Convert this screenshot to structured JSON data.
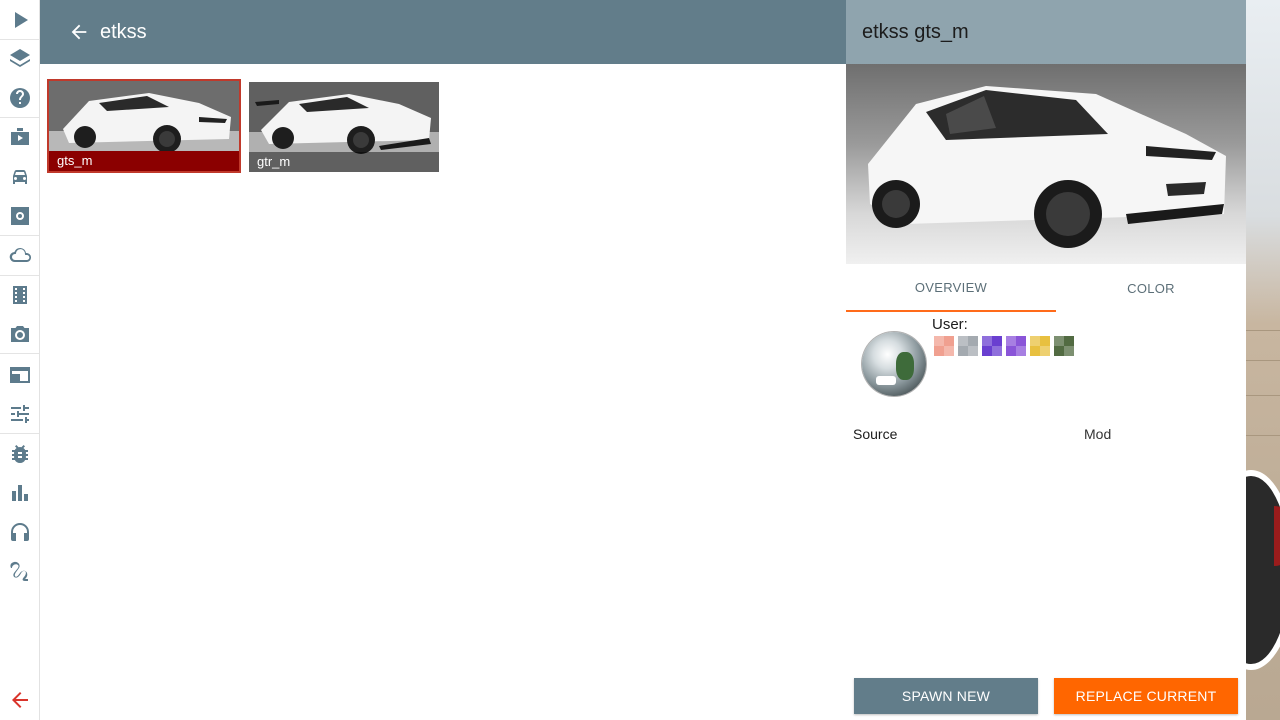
{
  "header": {
    "title": "etkss"
  },
  "sidebar": {
    "items": [
      {
        "icon": "play-icon"
      },
      {
        "icon": "layers-icon"
      },
      {
        "icon": "help-icon"
      },
      {
        "icon": "briefcase-icon"
      },
      {
        "icon": "car-icon"
      },
      {
        "icon": "settings-icon"
      },
      {
        "icon": "cloud-icon"
      },
      {
        "icon": "film-icon"
      },
      {
        "icon": "camera-icon"
      },
      {
        "icon": "window-icon"
      },
      {
        "icon": "sliders-icon"
      },
      {
        "icon": "bug-icon"
      },
      {
        "icon": "bar-chart-icon"
      },
      {
        "icon": "headphones-icon"
      },
      {
        "icon": "route-icon"
      }
    ],
    "back_icon": "arrow-left-icon"
  },
  "configs": [
    {
      "label": "gts_m",
      "selected": true
    },
    {
      "label": "gtr_m",
      "selected": false
    }
  ],
  "details": {
    "title": "etkss gts_m",
    "tabs": [
      {
        "label": "OVERVIEW",
        "active": true
      },
      {
        "label": "COLOR",
        "active": false
      }
    ],
    "user_label": "User:",
    "swatches": [
      "#f0a090",
      "#a4aab0",
      "#6a3fd0",
      "#8a55d8",
      "#e8c040",
      "#526b42"
    ],
    "source_key": "Source",
    "source_value": "Mod"
  },
  "actions": {
    "spawn_new": "SPAWN NEW",
    "replace_current": "REPLACE CURRENT"
  },
  "colors": {
    "header_bg": "#627d8a",
    "panel_header_bg": "#8fa4ae",
    "accent": "#ff6600",
    "selected_label": "#8b0000",
    "icon": "#5d7b8c",
    "back_icon": "#d9342b"
  }
}
